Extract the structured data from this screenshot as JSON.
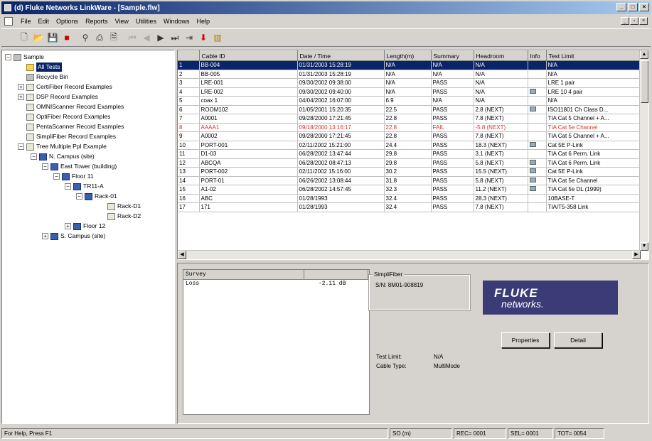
{
  "window": {
    "title": "(d) Fluke Networks LinkWare - [Sample.flw]"
  },
  "menu": [
    "File",
    "Edit",
    "Options",
    "Reports",
    "View",
    "Utilities",
    "Windows",
    "Help"
  ],
  "tree": {
    "root": "Sample",
    "all_tests": "All Tests",
    "recycle_bin": "Recycle Bin",
    "items": [
      "CertiFiber Record Examples",
      "DSP Record Examples",
      "OMNIScanner Record Examples",
      "OptiFiber Record Examples",
      "PentaScanner Record Examples",
      "SimpliFiber Record Examples"
    ],
    "tree_example": "Tree Multiple Ppl Example",
    "n_campus": "N. Campus (site)",
    "east_tower": "East Tower (building)",
    "floor11": "Floor 11",
    "tr11a": "TR11-A",
    "rack01": "Rack-01",
    "rackd1": "Rack-D1",
    "rackd2": "Rack-D2",
    "floor12": "Floor 12",
    "s_campus": "S. Campus (site)"
  },
  "table": {
    "headers": [
      "",
      "Cable ID",
      "Date / Time",
      "Length(m)",
      "Summary",
      "Headroom",
      "Info",
      "Test Limit"
    ],
    "rows": [
      [
        "1",
        "BB-004",
        "01/31/2003 15:28:19",
        "N/A",
        "N/A",
        "N/A",
        "",
        "N/A"
      ],
      [
        "2",
        "BB-005",
        "01/31/2003 15:28:19",
        "N/A",
        "N/A",
        "N/A",
        "",
        "N/A"
      ],
      [
        "3",
        "LRE-001",
        "09/30/2002 09:38:00",
        "N/A",
        "PASS",
        "N/A",
        "",
        "LRE 1 pair"
      ],
      [
        "4",
        "LRE-002",
        "09/30/2002 09:40:00",
        "N/A",
        "PASS",
        "N/A",
        "i",
        "LRE 10 4 pair"
      ],
      [
        "5",
        "coax 1",
        "04/04/2002 16:07:00",
        "6.9",
        "N/A",
        "N/A",
        "",
        "N/A"
      ],
      [
        "6",
        "ROOM102",
        "01/05/2001 15:20:35",
        "22.5",
        "PASS",
        "2.8 (NEXT)",
        "i",
        "ISO11801 Ch Class D..."
      ],
      [
        "7",
        "A0001",
        "09/28/2000 17:21:45",
        "22.8",
        "PASS",
        "7.8 (NEXT)",
        "",
        "TIA Cat 5 Channel + A..."
      ],
      [
        "8",
        "AAAA1",
        "09/18/2000 13:16:17",
        "22.8",
        "FAIL",
        "-5.8 (NEXT)",
        "",
        "TIA Cat 5e Channel"
      ],
      [
        "9",
        "A0002",
        "09/28/2000 17:21:45",
        "22.8",
        "PASS",
        "7.8 (NEXT)",
        "",
        "TIA Cat 5 Channel + A..."
      ],
      [
        "10",
        "PORT-001",
        "02/11/2002 15:21:00",
        "24.4",
        "PASS",
        "18.3 (NEXT)",
        "i",
        "Cat 5E P-Link"
      ],
      [
        "11",
        "D1-03",
        "06/28/2002 13:47:44",
        "29.8",
        "PASS",
        "3.1 (NEXT)",
        "",
        "TIA Cat 6 Perm. Link"
      ],
      [
        "12",
        "ABCQA",
        "06/28/2002 08:47:13",
        "29.8",
        "PASS",
        "5.8 (NEXT)",
        "i",
        "TIA Cat 6 Perm. Link"
      ],
      [
        "13",
        "PORT-002",
        "02/11/2002 15:16:00",
        "30.2",
        "PASS",
        "15.5 (NEXT)",
        "i",
        "Cat 5E P-Link"
      ],
      [
        "14",
        "PORT-01",
        "06/26/2002 13:08:44",
        "31.8",
        "PASS",
        "5.8 (NEXT)",
        "i",
        "TIA Cat 5e Channel"
      ],
      [
        "15",
        "A1-02",
        "06/28/2002 14:57:45",
        "32.3",
        "PASS",
        "11.2 (NEXT)",
        "i",
        "TIA Cat 5e DL (1999)"
      ],
      [
        "16",
        "ABC",
        "01/28/1993",
        "32.4",
        "PASS",
        "28.3 (NEXT)",
        "",
        "10BASE-T"
      ],
      [
        "17",
        "171",
        "01/28/1993",
        "32.4",
        "PASS",
        "7.8 (NEXT)",
        "",
        "TIA/T5-358 Link"
      ]
    ]
  },
  "results": {
    "col1": "Survey",
    "row_label": "Loss",
    "row_value": "-2.11 dB"
  },
  "device": {
    "group_label": "SimpliFiber",
    "serial": "S/N: 8M01-908819"
  },
  "logo": {
    "line1": "FLUKE",
    "line2": "networks."
  },
  "buttons": {
    "properties": "Properties",
    "detail": "Detail"
  },
  "info": {
    "test_limit_label": "Test Limit:",
    "test_limit_value": "N/A",
    "cable_type_label": "Cable Type:",
    "cable_type_value": "MultiMode"
  },
  "status": {
    "help": "For Help, Press F1",
    "units": "SO (m)",
    "rec": "REC= 0001",
    "sel": "SEL= 0001",
    "tot": "TOT= 0054"
  }
}
